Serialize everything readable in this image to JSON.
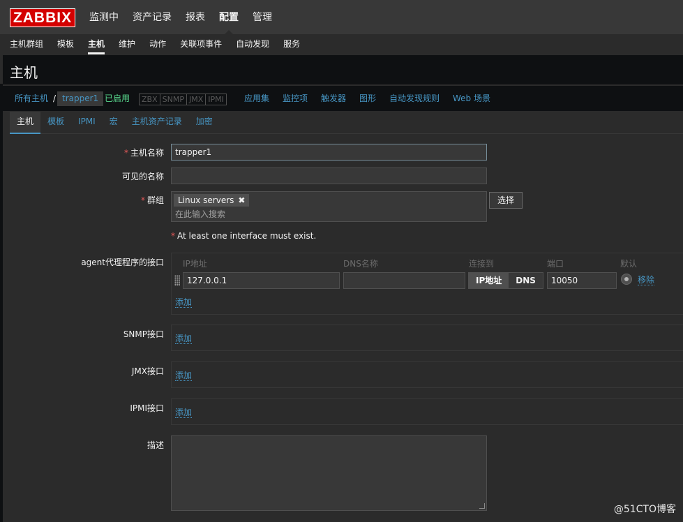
{
  "header": {
    "logo": "ZABBIX",
    "menu": [
      "监测中",
      "资产记录",
      "报表",
      "配置",
      "管理"
    ],
    "active_menu": 3
  },
  "submenu": {
    "items": [
      "主机群组",
      "模板",
      "主机",
      "维护",
      "动作",
      "关联项事件",
      "自动发现",
      "服务"
    ],
    "active": 2
  },
  "page": {
    "title": "主机"
  },
  "nav": {
    "all_hosts": "所有主机",
    "separator": "/",
    "current_host": "trapper1",
    "status": "已启用",
    "availability": [
      "ZBX",
      "SNMP",
      "JMX",
      "IPMI"
    ],
    "links": [
      "应用集",
      "监控项",
      "触发器",
      "图形",
      "自动发现规则",
      "Web 场景"
    ]
  },
  "tabs": {
    "items": [
      "主机",
      "模板",
      "IPMI",
      "宏",
      "主机资产记录",
      "加密"
    ],
    "active": 0
  },
  "form": {
    "host_name_label": "主机名称",
    "host_name_value": "trapper1",
    "visible_name_label": "可见的名称",
    "visible_name_value": "",
    "groups_label": "群组",
    "group_chip": "Linux servers",
    "group_placeholder": "在此输入搜索",
    "select_button": "选择",
    "required_mark": "*",
    "interface_warning": "At least one interface must exist.",
    "agent_label": "agent代理程序的接口",
    "col_ip": "IP地址",
    "col_dns": "DNS名称",
    "col_connect": "连接到",
    "col_port": "端口",
    "col_default": "默认",
    "ip_value": "127.0.0.1",
    "dns_value": "",
    "connect_ip": "IP地址",
    "connect_dns": "DNS",
    "port_value": "10050",
    "remove_link": "移除",
    "add_link": "添加",
    "snmp_label": "SNMP接口",
    "jmx_label": "JMX接口",
    "ipmi_label": "IPMI接口",
    "description_label": "描述",
    "description_value": ""
  },
  "watermark": "@51CTO博客"
}
